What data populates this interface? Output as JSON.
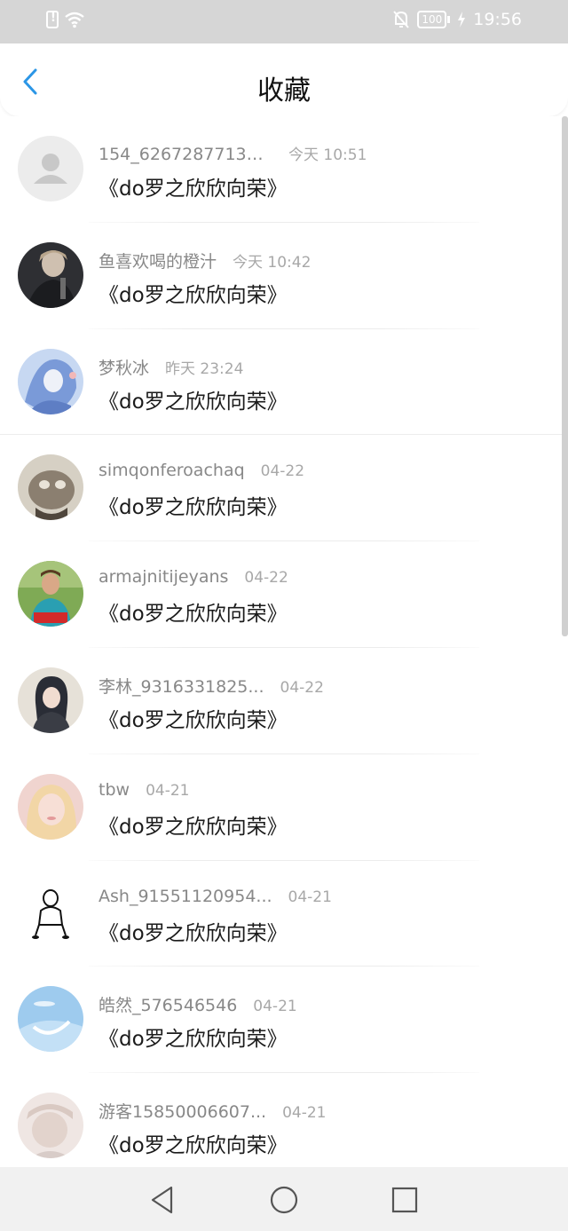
{
  "status_bar": {
    "time": "19:56",
    "battery": "100",
    "icons": [
      "sim-alert-icon",
      "wifi-icon",
      "bell-off-icon",
      "battery-icon",
      "charging-icon"
    ]
  },
  "header": {
    "title": "收藏",
    "back_icon": "chevron-left-icon",
    "accent_color": "#2b96e6"
  },
  "list": {
    "items": [
      {
        "username": "154_62672877138...",
        "time": "今天 10:51",
        "title": "《do罗之欣欣向荣》",
        "avatar": "default-avatar"
      },
      {
        "username": "鱼喜欢喝的橙汁",
        "time": "今天 10:42",
        "title": "《do罗之欣欣向荣》",
        "avatar": "photo-avatar"
      },
      {
        "username": "梦秋冰",
        "time": "昨天 23:24",
        "title": "《do罗之欣欣向荣》",
        "avatar": "photo-avatar"
      },
      {
        "username": "simqonferoachaq",
        "time": "04-22",
        "title": "《do罗之欣欣向荣》",
        "avatar": "photo-avatar"
      },
      {
        "username": "armajnitijeyans",
        "time": "04-22",
        "title": "《do罗之欣欣向荣》",
        "avatar": "photo-avatar"
      },
      {
        "username": "李林_9316331825...",
        "time": "04-22",
        "title": "《do罗之欣欣向荣》",
        "avatar": "photo-avatar"
      },
      {
        "username": "tbw",
        "time": "04-21",
        "title": "《do罗之欣欣向荣》",
        "avatar": "photo-avatar"
      },
      {
        "username": "Ash_91551120954...",
        "time": "04-21",
        "title": "《do罗之欣欣向荣》",
        "avatar": "sketch-avatar"
      },
      {
        "username": "皓然_576546546",
        "time": "04-21",
        "title": "《do罗之欣欣向荣》",
        "avatar": "photo-avatar"
      },
      {
        "username": "游客15850006607...",
        "time": "04-21",
        "title": "《do罗之欣欣向荣》",
        "avatar": "photo-avatar"
      }
    ]
  },
  "nav_bar": {
    "back_icon": "triangle-back-icon",
    "home_icon": "circle-home-icon",
    "recents_icon": "square-recents-icon"
  }
}
